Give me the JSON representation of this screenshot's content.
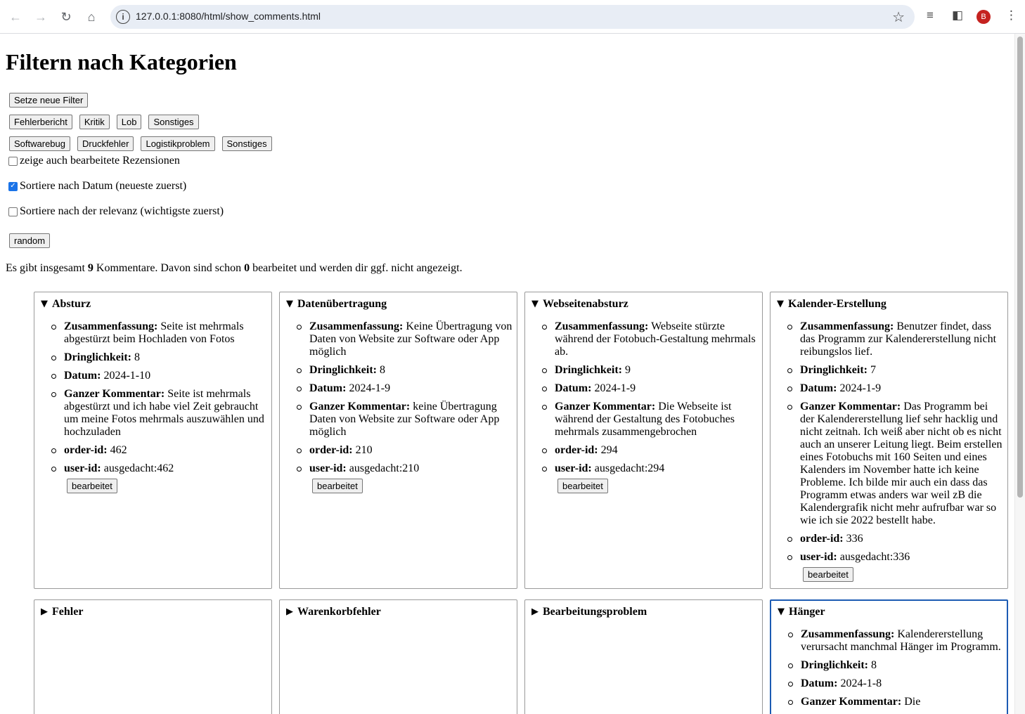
{
  "browser": {
    "url": "127.0.0.1:8080/html/show_comments.html",
    "avatar_letter": "B"
  },
  "page": {
    "title": "Filtern nach Kategorien",
    "set_filter_button": "Setze neue Filter",
    "category_buttons": [
      "Fehlerbericht",
      "Kritik",
      "Lob",
      "Sonstiges"
    ],
    "subcategory_buttons": [
      "Softwarebug",
      "Druckfehler",
      "Logistikproblem",
      "Sonstiges"
    ],
    "checkbox_show_edited": "zeige auch bearbeitete Rezensionen",
    "checkbox_sort_date": "Sortiere nach Datum (neueste zuerst)",
    "checkbox_sort_relevance": "Sortiere nach der relevanz (wichtigste zuerst)",
    "random_button": "random",
    "summary_part1": "Es gibt insgesamt ",
    "summary_total": "9",
    "summary_part2": " Kommentare. Davon sind schon ",
    "summary_edited": "0",
    "summary_part3": " bearbeitet und werden dir ggf. nicht angezeigt."
  },
  "labels": {
    "summary": "Zusammenfassung:",
    "urgency": "Dringlichkeit:",
    "date": "Datum:",
    "full_comment": "Ganzer Kommentar:",
    "order_id": "order-id:",
    "user_id": "user-id:",
    "edited_button": "bearbeitet"
  },
  "cards": [
    {
      "title": "Absturz",
      "open": true,
      "summary": "Seite ist mehrmals abgestürzt beim Hochladen von Fotos",
      "urgency": "8",
      "date": "2024-1-10",
      "full_comment": "Seite ist mehrmals abgestürzt und ich habe viel Zeit gebraucht um meine Fotos mehrmals auszuwählen und hochzuladen",
      "order_id": "462",
      "user_id": "ausgedacht:462"
    },
    {
      "title": "Datenübertragung",
      "open": true,
      "summary": "Keine Übertragung von Daten von Website zur Software oder App möglich",
      "urgency": "8",
      "date": "2024-1-9",
      "full_comment": "keine Übertragung Daten von Website zur Software oder App möglich",
      "order_id": "210",
      "user_id": "ausgedacht:210"
    },
    {
      "title": "Webseitenabsturz",
      "open": true,
      "summary": "Webseite stürzte während der Fotobuch-Gestaltung mehrmals ab.",
      "urgency": "9",
      "date": "2024-1-9",
      "full_comment": "Die Webseite ist während der Gestaltung des Fotobuches mehrmals zusammengebrochen",
      "order_id": "294",
      "user_id": "ausgedacht:294"
    },
    {
      "title": "Kalender-Erstellung",
      "open": true,
      "summary": "Benutzer findet, dass das Programm zur Kalendererstellung nicht reibungslos lief.",
      "urgency": "7",
      "date": "2024-1-9",
      "full_comment": "Das Programm bei der Kalendererstellung lief sehr hacklig und nicht zeitnah. Ich weiß aber nicht ob es nicht auch an unserer Leitung liegt. Beim erstellen eines Fotobuchs mit 160 Seiten und eines Kalenders im November hatte ich keine Probleme. Ich bilde mir auch ein dass das Programm etwas anders war weil zB die Kalendergrafik nicht mehr aufrufbar war so wie ich sie 2022 bestellt habe.",
      "order_id": "336",
      "user_id": "ausgedacht:336"
    },
    {
      "title": "Fehler",
      "open": false
    },
    {
      "title": "Warenkorbfehler",
      "open": false
    },
    {
      "title": "Bearbeitungsproblem",
      "open": false
    },
    {
      "title": "Hänger",
      "open": true,
      "summary": "Kalendererstellung verursacht manchmal Hänger im Programm.",
      "urgency": "8",
      "date": "2024-1-8",
      "full_comment": "Die"
    }
  ]
}
